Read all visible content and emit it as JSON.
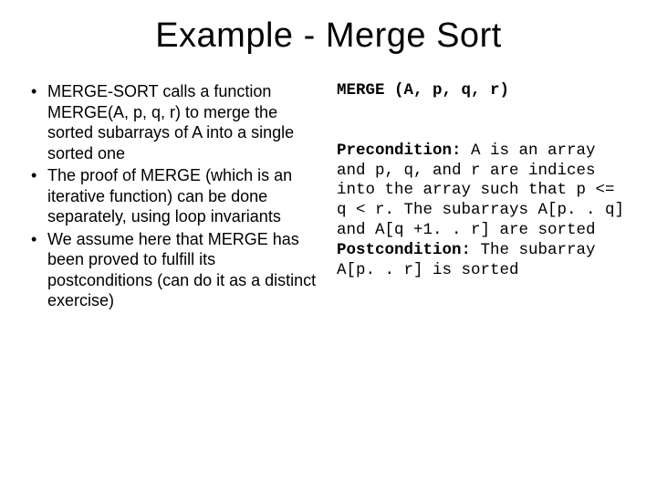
{
  "title": "Example - Merge Sort",
  "bullets": [
    "MERGE-SORT calls a function MERGE(A, p, q, r) to merge the sorted subarrays of A into a single sorted one",
    "The proof of MERGE (which is an iterative function) can be done separately, using loop invariants",
    "We assume here that MERGE has been  proved to fulfill its postconditions (can do it as a distinct exercise)"
  ],
  "code": {
    "signature": "MERGE (A, p, q, r)",
    "precond_label": "Precondition:",
    "precond_body": " A is an array and p, q, and r are indices into the array such that p <= q < r. The subarrays A[p. . q] and A[q +1. . r] are sorted",
    "postcond_label": "Postcondition:",
    "postcond_body": " The subarray A[p. . r] is sorted"
  }
}
